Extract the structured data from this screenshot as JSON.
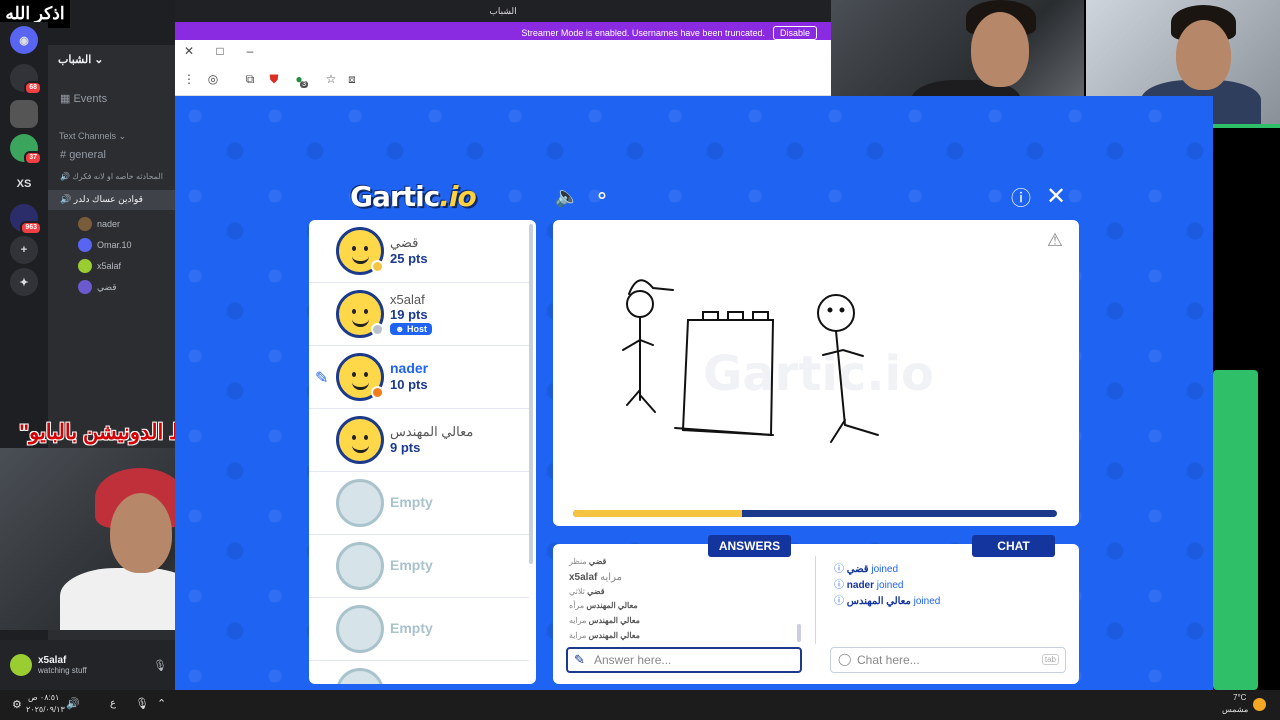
{
  "overlay": {
    "top_left_text": "اذكر الله",
    "donation_text": "\"رابط الدونيشن بالبايو\""
  },
  "browser": {
    "window_title": "الشباب",
    "streamer_banner": "Streamer Mode is enabled. Usernames have been truncated.",
    "disable_label": "Disable",
    "extension_badge": "3"
  },
  "discord": {
    "server_name": "الشباب",
    "rail_badges": [
      "68",
      "37",
      "963"
    ],
    "rail_xs": "XS",
    "events_label": "Events",
    "text_channels_label": "Text Channels",
    "channels": [
      "general",
      "المحادثه خاصه او لانه فكرك"
    ],
    "voice_channel": "قوادين عساك دلدر",
    "voice_users": [
      "nader",
      "Omar.10",
      "x5alaf",
      "قضي"
    ],
    "user": {
      "name": "x5alaf",
      "status": "watching stuff"
    }
  },
  "gartic": {
    "logo_main": "Gartic",
    "logo_suffix": ".io",
    "players": [
      {
        "name": "قضي",
        "points": "25 pts",
        "status_color": "#f5c542"
      },
      {
        "name": "x5alaf",
        "points": "19 pts",
        "status_color": "#b9c2cc",
        "host": "Host"
      },
      {
        "name": "nader",
        "points": "10 pts",
        "status_color": "#f07c1b",
        "drawing": true
      },
      {
        "name": "معالي المهندس",
        "points": "9 pts"
      },
      {
        "name": "Empty"
      },
      {
        "name": "Empty"
      },
      {
        "name": "Empty"
      }
    ],
    "progress": 0.35,
    "answers_label": "ANSWERS",
    "chat_label": "CHAT",
    "answers": [
      {
        "user": "قضي",
        "text": "منظر"
      },
      {
        "user": "x5alaf",
        "text": "مرايه"
      },
      {
        "user": "قضي",
        "text": "ثلاثي"
      },
      {
        "user": "معالي المهندس",
        "text": "مرأه"
      },
      {
        "user": "معالي المهندس",
        "text": "مرايه"
      },
      {
        "user": "معالي المهندس",
        "text": "مراية"
      }
    ],
    "chat": [
      {
        "user": "قضي",
        "text": "joined"
      },
      {
        "user": "nader",
        "text": "joined"
      },
      {
        "user": "معالي المهندس",
        "text": "joined"
      }
    ],
    "answer_placeholder": "Answer here...",
    "chat_placeholder": "Chat here...",
    "chat_key_hint": "tab"
  },
  "taskbar": {
    "time": "٠٨:٥١ ص",
    "date": "٢٠٢٥/٠٩/١٣",
    "weather_temp": "7°C",
    "weather_desc": "مشمس",
    "lang": "ع"
  }
}
